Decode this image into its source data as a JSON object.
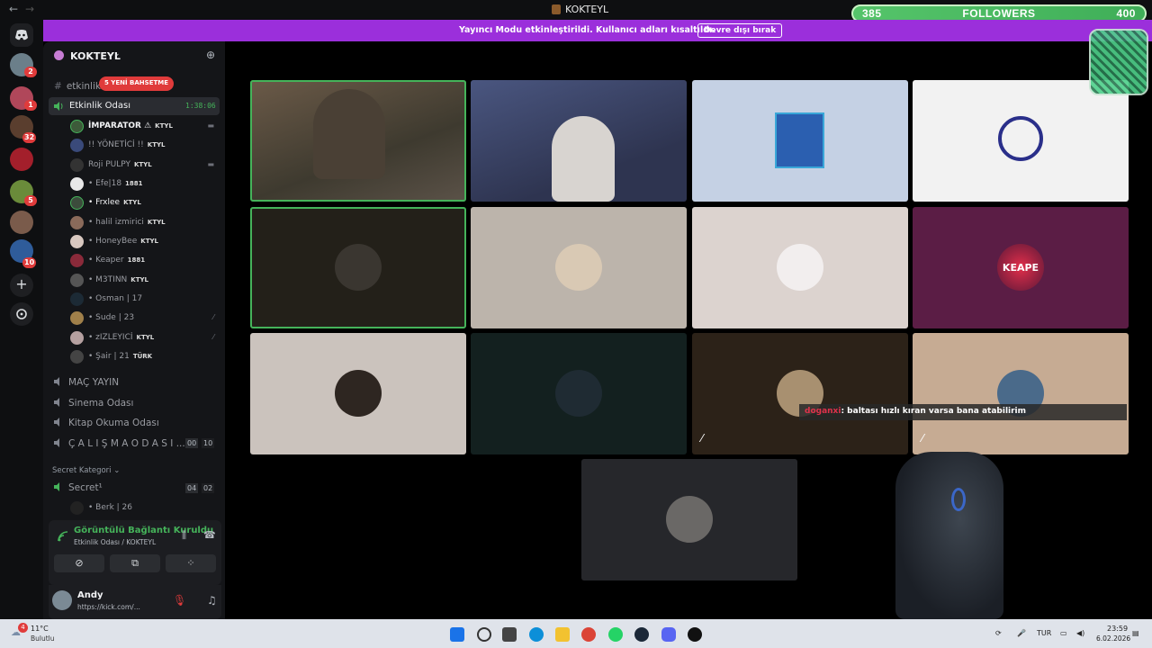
{
  "window": {
    "title": "KOKTEYL",
    "back_icon": "arrow-left-icon",
    "forward_icon": "arrow-right-icon"
  },
  "followers": {
    "current": "385",
    "label": "FOLLOWERS",
    "goal": "400",
    "progress": 0.9625
  },
  "rail": {
    "badges": [
      "2",
      "1",
      "32",
      "5",
      "10"
    ]
  },
  "banner": {
    "text": "Yayıncı Modu etkinleştirildi. Kullanıcı adları kısaltıldı.",
    "button": "Devre dışı bırak"
  },
  "server": {
    "name": "KOKTEYL"
  },
  "channels": {
    "top_channel": "etkinlik",
    "new_events_badge": "5 YENİ BAHSETME",
    "active_channel": "Etkinlik Odası",
    "active_timer": "1:38:06",
    "members": [
      {
        "name": "İMPARATOR ⚠",
        "tag": "KTYL"
      },
      {
        "name": "!! YÖNETİCİ !!",
        "tag": "KTYL"
      },
      {
        "name": "Roji PULPY",
        "tag": "KTYL"
      },
      {
        "name": "• Efe|18",
        "tag": "1881"
      },
      {
        "name": "• Frxlee",
        "tag": "KTYL"
      },
      {
        "name": "• halil izmirici",
        "tag": "KTYL"
      },
      {
        "name": "• HoneyBee",
        "tag": "KTYL"
      },
      {
        "name": "• Keaper",
        "tag": "1881"
      },
      {
        "name": "• M3TINN",
        "tag": "KTYL"
      },
      {
        "name": "• Osman | 17",
        "tag": ""
      },
      {
        "name": "• Sude | 23",
        "tag": ""
      },
      {
        "name": "• zIZLEYICİ",
        "tag": "KTYL"
      },
      {
        "name": "• Şair | 21",
        "tag": "TÜRK"
      }
    ],
    "voice_channels": [
      {
        "name": "MAÇ YAYIN"
      },
      {
        "name": "Sinema Odası"
      },
      {
        "name": "Kitap Okuma Odası"
      },
      {
        "name": "Ç A L I Ş M A O D A S I ...",
        "count": "00",
        "limit": "10"
      }
    ],
    "category": "Secret Kategori",
    "secret_channel": {
      "name": "Secret¹",
      "count": "04",
      "limit": "02"
    },
    "secret_member": "• Berk | 26"
  },
  "voice_status": {
    "title": "Görüntülü Bağlantı Kuruldu",
    "subtitle": "Etkinlik Odası / KOKTEYL"
  },
  "user": {
    "name": "Andy",
    "status": "https://kick.com/..."
  },
  "stage": {
    "caption_user": "doganxi",
    "caption_text": ": baltası hızlı kıran varsa bana atabilirim",
    "tile_text": "KEAPE"
  },
  "taskbar": {
    "weather_temp": "11°C",
    "weather_desc": "Bulutlu",
    "weather_badge": "4",
    "lang": "TUR",
    "time": "23:59",
    "date": "6.02.2026"
  },
  "colors": {
    "accent_green": "#45b35a",
    "banner_purple": "#9b2fdb",
    "badge_red": "#e03b3b"
  }
}
